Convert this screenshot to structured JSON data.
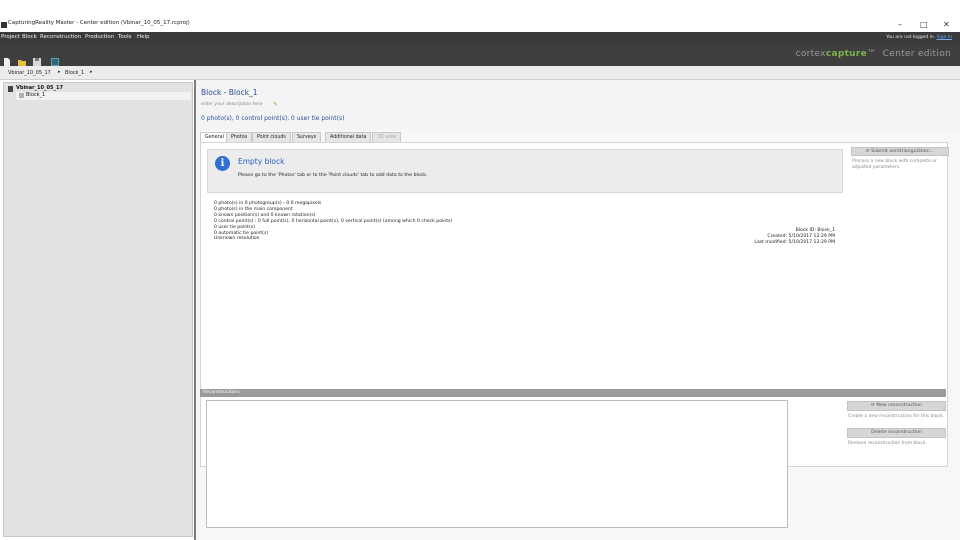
{
  "window": {
    "title": "CapturingReality Master - Center edition (Vbinar_10_05_17.rcproj)",
    "controls": {
      "minimize": "–",
      "maximize": "□",
      "close": "✕"
    }
  },
  "menu": {
    "items": [
      "Project",
      "Block",
      "Reconstruction",
      "Production",
      "Tools",
      "Help"
    ],
    "login_text": "You are not logged in.",
    "login_link": "Sign in"
  },
  "toolbar": {
    "icons": [
      "new-project-icon",
      "open-project-icon",
      "save-icon",
      "image-icon"
    ],
    "brand_prefix": "cortex",
    "brand_accent": "capture",
    "brand_tm": "™",
    "brand_edition": "Center edition"
  },
  "breadcrumb": {
    "items": [
      "Vbinar_10_05_17",
      "Block_1"
    ],
    "separator": "▸"
  },
  "tree": {
    "root": "Vbinar_10_05_17",
    "child": "Block_1"
  },
  "block": {
    "title": "Block - Block_1",
    "description_placeholder": "enter your description here",
    "summary": "0 photo(s), 0 control point(s), 0 user tie point(s)"
  },
  "tabs": [
    {
      "label": "General",
      "state": "active"
    },
    {
      "label": "Photos",
      "state": "normal"
    },
    {
      "label": "Point clouds",
      "state": "normal"
    },
    {
      "label": "Surveys",
      "state": "normal"
    },
    {
      "label": "Additional data",
      "state": "normal"
    },
    {
      "label": "3D view",
      "state": "disabled"
    }
  ],
  "info": {
    "title": "Empty block",
    "message": "Please go to the 'Photos' tab or to the 'Point clouds' tab to add data to the block."
  },
  "stats": [
    "0 photo(s) in 0 photogroup(s) - 0.0 megapixels",
    "0 photo(s) in the main component",
    "0 known position(s) and 0 known rotation(s)",
    "0 control point(s) : 0 full point(s), 0 horizontal point(s), 0 vertical point(s) (among which 0 check points)",
    "0 user tie point(s)",
    "0 automatic tie point(s)",
    "Unknown resolution"
  ],
  "meta": {
    "block_id": "Block ID: Block_1",
    "created": "Created: 5/10/2017 12:29 PM",
    "last_modified": "Last modified: 5/10/2017 12:29 PM"
  },
  "side_actions": {
    "submit_button": "Submit aerotriangulation...",
    "submit_note": "Process a new block with complete or adjusted parameters."
  },
  "reconstructions": {
    "header": "Reconstructions",
    "new_button": "New reconstruction",
    "new_note": "Create a new reconstruction for this block.",
    "delete_button": "Delete reconstruction",
    "delete_note": "Remove reconstruction from block."
  },
  "colors": {
    "accent_blue": "#2a4c9a",
    "info_blue": "#2e6fd1",
    "brand_green": "#7fb24a",
    "dark_bar": "#3b3b3b"
  }
}
